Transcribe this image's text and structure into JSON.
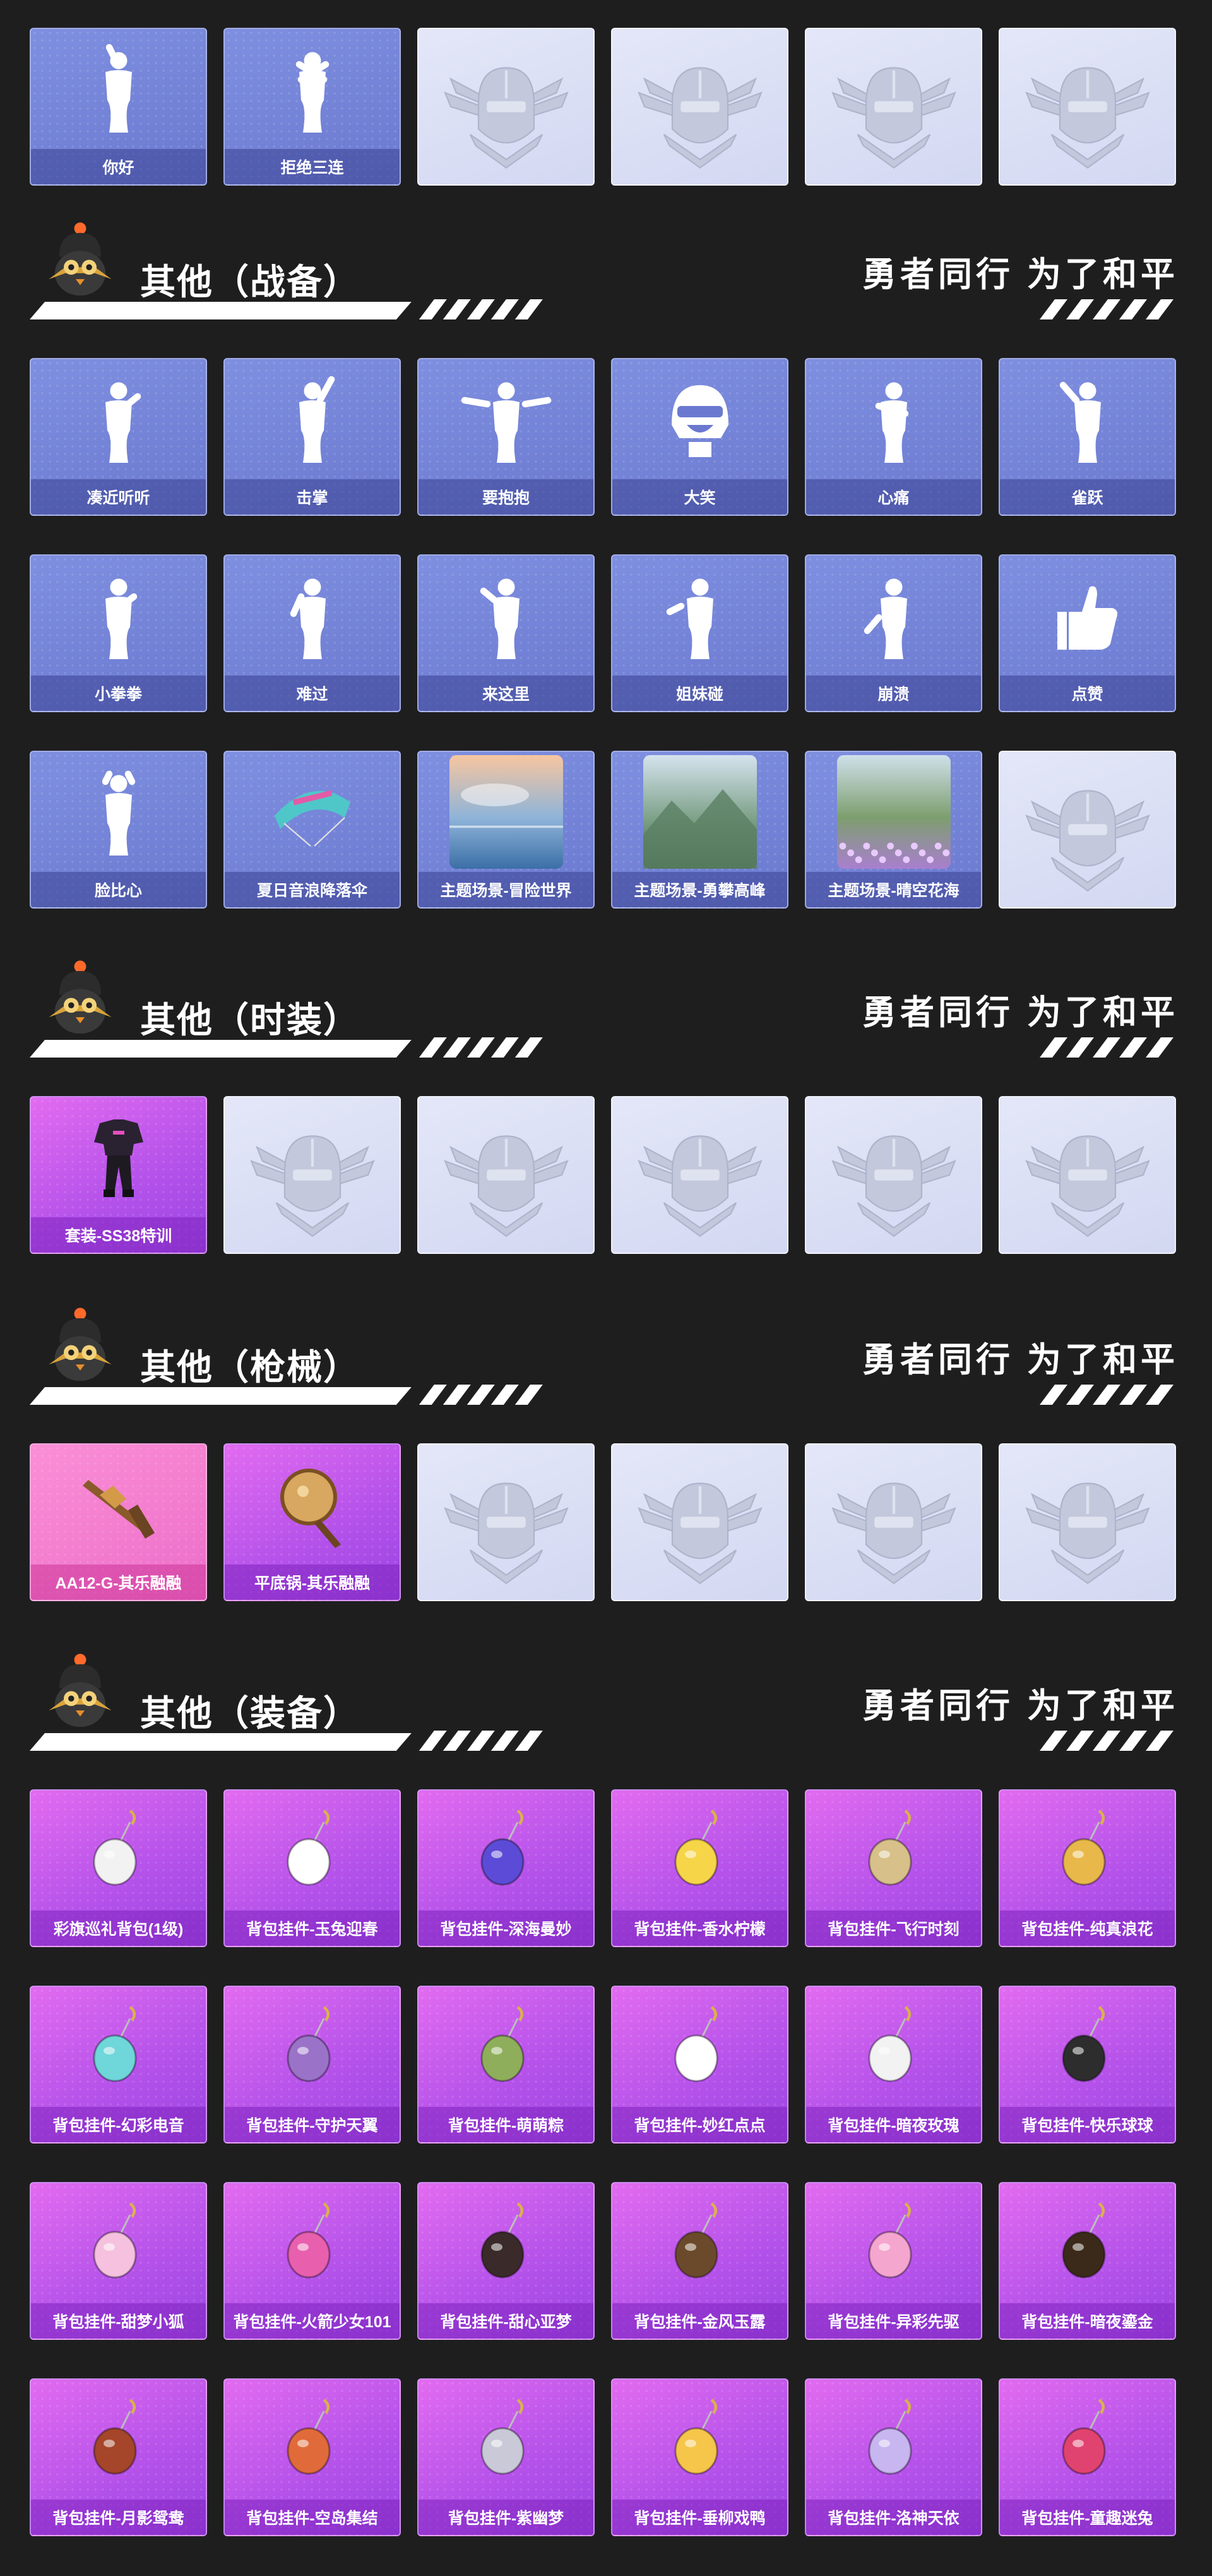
{
  "slogan": "勇者同行 为了和平",
  "sections": [
    {
      "title": null,
      "rows": [
        [
          {
            "label": "你好",
            "style": "blue",
            "icon": "wave-pose-icon"
          },
          {
            "label": "拒绝三连",
            "style": "blue",
            "icon": "cross-arms-pose-icon"
          },
          {
            "label": "",
            "style": "empty",
            "icon": "helmet-emblem-icon"
          },
          {
            "label": "",
            "style": "empty",
            "icon": "helmet-emblem-icon"
          },
          {
            "label": "",
            "style": "empty",
            "icon": "helmet-emblem-icon"
          },
          {
            "label": "",
            "style": "empty",
            "icon": "helmet-emblem-icon"
          }
        ]
      ]
    },
    {
      "title": "其他（战备）",
      "rows": [
        [
          {
            "label": "凑近听听",
            "style": "blue",
            "icon": "listen-pose-icon"
          },
          {
            "label": "击掌",
            "style": "blue",
            "icon": "high-five-pose-icon"
          },
          {
            "label": "要抱抱",
            "style": "blue",
            "icon": "hug-pose-icon"
          },
          {
            "label": "大笑",
            "style": "blue",
            "icon": "laugh-helmet-icon"
          },
          {
            "label": "心痛",
            "style": "blue",
            "icon": "heartache-pose-icon"
          },
          {
            "label": "雀跃",
            "style": "blue",
            "icon": "cheer-pose-icon"
          }
        ],
        [
          {
            "label": "小拳拳",
            "style": "blue",
            "icon": "fist-pose-icon"
          },
          {
            "label": "难过",
            "style": "blue",
            "icon": "sad-pose-icon"
          },
          {
            "label": "来这里",
            "style": "blue",
            "icon": "come-here-pose-icon"
          },
          {
            "label": "姐妹碰",
            "style": "blue",
            "icon": "bump-pose-icon"
          },
          {
            "label": "崩溃",
            "style": "blue",
            "icon": "collapse-pose-icon"
          },
          {
            "label": "点赞",
            "style": "blue",
            "icon": "thumbs-up-icon"
          }
        ],
        [
          {
            "label": "脸比心",
            "style": "blue",
            "icon": "heart-face-pose-icon"
          },
          {
            "label": "夏日音浪降落伞",
            "style": "blue",
            "icon": "parachute-icon"
          },
          {
            "label": "主题场景-冒险世界",
            "style": "blue",
            "icon": "scene-sea-icon"
          },
          {
            "label": "主题场景-勇攀高峰",
            "style": "blue",
            "icon": "scene-mountain-icon"
          },
          {
            "label": "主题场景-晴空花海",
            "style": "blue",
            "icon": "scene-flowers-icon"
          },
          {
            "label": "",
            "style": "empty",
            "icon": "helmet-emblem-icon"
          }
        ]
      ]
    },
    {
      "title": "其他（时装）",
      "rows": [
        [
          {
            "label": "套装-SS38特训",
            "style": "purple",
            "icon": "outfit-icon"
          },
          {
            "label": "",
            "style": "empty",
            "icon": "helmet-emblem-icon"
          },
          {
            "label": "",
            "style": "empty",
            "icon": "helmet-emblem-icon"
          },
          {
            "label": "",
            "style": "empty",
            "icon": "helmet-emblem-icon"
          },
          {
            "label": "",
            "style": "empty",
            "icon": "helmet-emblem-icon"
          },
          {
            "label": "",
            "style": "empty",
            "icon": "helmet-emblem-icon"
          }
        ]
      ]
    },
    {
      "title": "其他（枪械）",
      "rows": [
        [
          {
            "label": "AA12-G-其乐融融",
            "style": "pink",
            "icon": "shotgun-icon"
          },
          {
            "label": "平底锅-其乐融融",
            "style": "purple",
            "icon": "pan-icon"
          },
          {
            "label": "",
            "style": "empty",
            "icon": "helmet-emblem-icon"
          },
          {
            "label": "",
            "style": "empty",
            "icon": "helmet-emblem-icon"
          },
          {
            "label": "",
            "style": "empty",
            "icon": "helmet-emblem-icon"
          },
          {
            "label": "",
            "style": "empty",
            "icon": "helmet-emblem-icon"
          }
        ]
      ]
    },
    {
      "title": "其他（装备）",
      "rows": [
        [
          {
            "label": "彩旗巡礼背包(1级)",
            "style": "purple",
            "icon": "backpack-icon"
          },
          {
            "label": "背包挂件-玉兔迎春",
            "style": "purple",
            "icon": "rabbit-charm-icon"
          },
          {
            "label": "背包挂件-深海曼妙",
            "style": "purple",
            "icon": "submarine-charm-icon"
          },
          {
            "label": "背包挂件-香水柠檬",
            "style": "purple",
            "icon": "lemon-drink-charm-icon"
          },
          {
            "label": "背包挂件-飞行时刻",
            "style": "purple",
            "icon": "plane-charm-icon"
          },
          {
            "label": "背包挂件-纯真浪花",
            "style": "purple",
            "icon": "bottle-opener-charm-icon"
          }
        ],
        [
          {
            "label": "背包挂件-幻彩电音",
            "style": "purple",
            "icon": "robot-charm-icon"
          },
          {
            "label": "背包挂件-守护天翼",
            "style": "purple",
            "icon": "wing-charm-icon"
          },
          {
            "label": "背包挂件-萌萌粽",
            "style": "purple",
            "icon": "zongzi-charm-icon"
          },
          {
            "label": "背包挂件-妙红点点",
            "style": "purple",
            "icon": "flower-charm-icon"
          },
          {
            "label": "背包挂件-暗夜玫瑰",
            "style": "purple",
            "icon": "bunny-charm-icon"
          },
          {
            "label": "背包挂件-快乐球球",
            "style": "purple",
            "icon": "ball-charm-icon"
          }
        ],
        [
          {
            "label": "背包挂件-甜梦小狐",
            "style": "purple",
            "icon": "mushroom-charm-icon"
          },
          {
            "label": "背包挂件-火箭少女101",
            "style": "purple",
            "icon": "rocket-charm-icon"
          },
          {
            "label": "背包挂件-甜心亚梦",
            "style": "purple",
            "icon": "paw-charm-icon"
          },
          {
            "label": "背包挂件-金风玉露",
            "style": "purple",
            "icon": "tassel-charm-icon"
          },
          {
            "label": "背包挂件-异彩先驱",
            "style": "purple",
            "icon": "skate-charm-icon"
          },
          {
            "label": "背包挂件-暗夜鎏金",
            "style": "purple",
            "icon": "gold-tassel-charm-icon"
          }
        ],
        [
          {
            "label": "背包挂件-月影鸳鸯",
            "style": "purple",
            "icon": "staff-charm-icon"
          },
          {
            "label": "背包挂件-空岛集结",
            "style": "purple",
            "icon": "gun-charm-icon"
          },
          {
            "label": "背包挂件-紫幽梦",
            "style": "purple",
            "icon": "bell-charm-icon"
          },
          {
            "label": "背包挂件-垂柳戏鸭",
            "style": "purple",
            "icon": "duck-charm-icon"
          },
          {
            "label": "背包挂件-洛神天依",
            "style": "purple",
            "icon": "bow-charm-icon"
          },
          {
            "label": "背包挂件-童趣迷兔",
            "style": "purple",
            "icon": "heart-charm-icon"
          }
        ]
      ]
    }
  ]
}
